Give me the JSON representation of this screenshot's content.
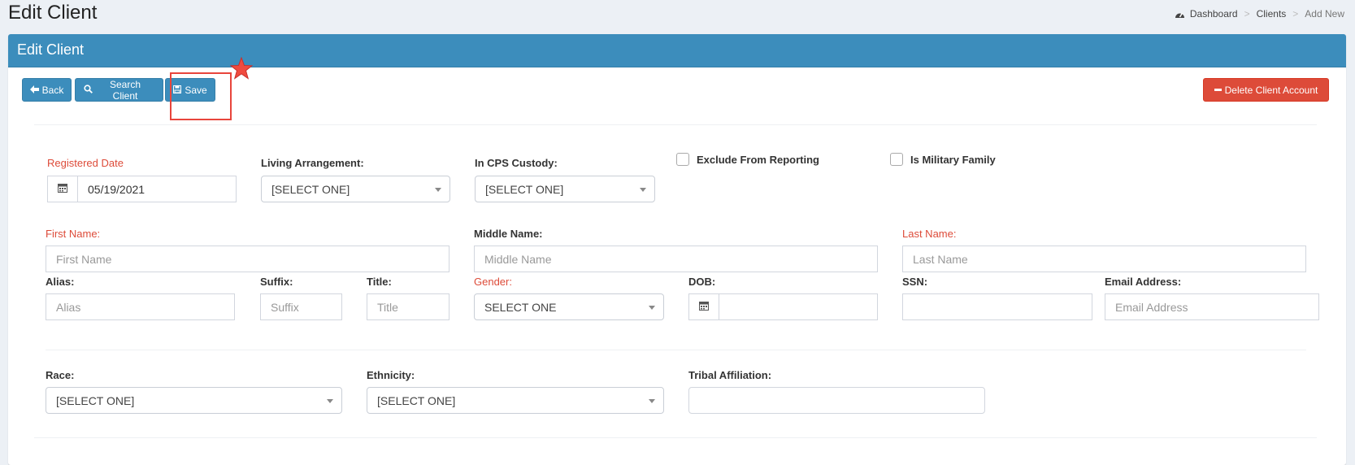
{
  "header": {
    "title": "Edit Client",
    "breadcrumb": {
      "dashboard": "Dashboard",
      "clients": "Clients",
      "current": "Add New"
    }
  },
  "box": {
    "title": "Edit Client"
  },
  "toolbar": {
    "back": "Back",
    "search_client": "Search Client",
    "save": "Save",
    "delete": "Delete Client Account"
  },
  "form": {
    "registered_date": {
      "label": "Registered Date",
      "value": "05/19/2021"
    },
    "living_arrangement": {
      "label": "Living Arrangement:",
      "value": "[SELECT ONE]"
    },
    "cps_custody": {
      "label": "In CPS Custody:",
      "value": "[SELECT ONE]"
    },
    "exclude_reporting": {
      "label": "Exclude From Reporting",
      "checked": false
    },
    "military_family": {
      "label": "Is Military Family",
      "checked": false
    },
    "first_name": {
      "label": "First Name:",
      "placeholder": "First Name"
    },
    "middle_name": {
      "label": "Middle Name:",
      "placeholder": "Middle Name"
    },
    "last_name": {
      "label": "Last Name:",
      "placeholder": "Last Name"
    },
    "alias": {
      "label": "Alias:",
      "placeholder": "Alias"
    },
    "suffix": {
      "label": "Suffix:",
      "placeholder": "Suffix"
    },
    "title": {
      "label": "Title:",
      "placeholder": "Title"
    },
    "gender": {
      "label": "Gender:",
      "value": "SELECT ONE"
    },
    "dob": {
      "label": "DOB:",
      "value": ""
    },
    "ssn": {
      "label": "SSN:",
      "value": ""
    },
    "email": {
      "label": "Email Address:",
      "placeholder": "Email Address"
    },
    "race": {
      "label": "Race:",
      "value": "[SELECT ONE]"
    },
    "ethnicity": {
      "label": "Ethnicity:",
      "value": "[SELECT ONE]"
    },
    "tribal_affiliation": {
      "label": "Tribal Affiliation:",
      "value": ""
    }
  },
  "icons": {
    "dashboard": "dashboard-icon",
    "back": "arrow-left-icon",
    "search": "search-icon",
    "save": "floppy-disk-icon",
    "delete": "minus-icon",
    "calendar": "calendar-icon",
    "annotation": "star-icon"
  },
  "colors": {
    "primary": "#3c8dbc",
    "danger": "#dd4b39",
    "required_label": "#dd4b39",
    "annotation": "#e8453c"
  }
}
